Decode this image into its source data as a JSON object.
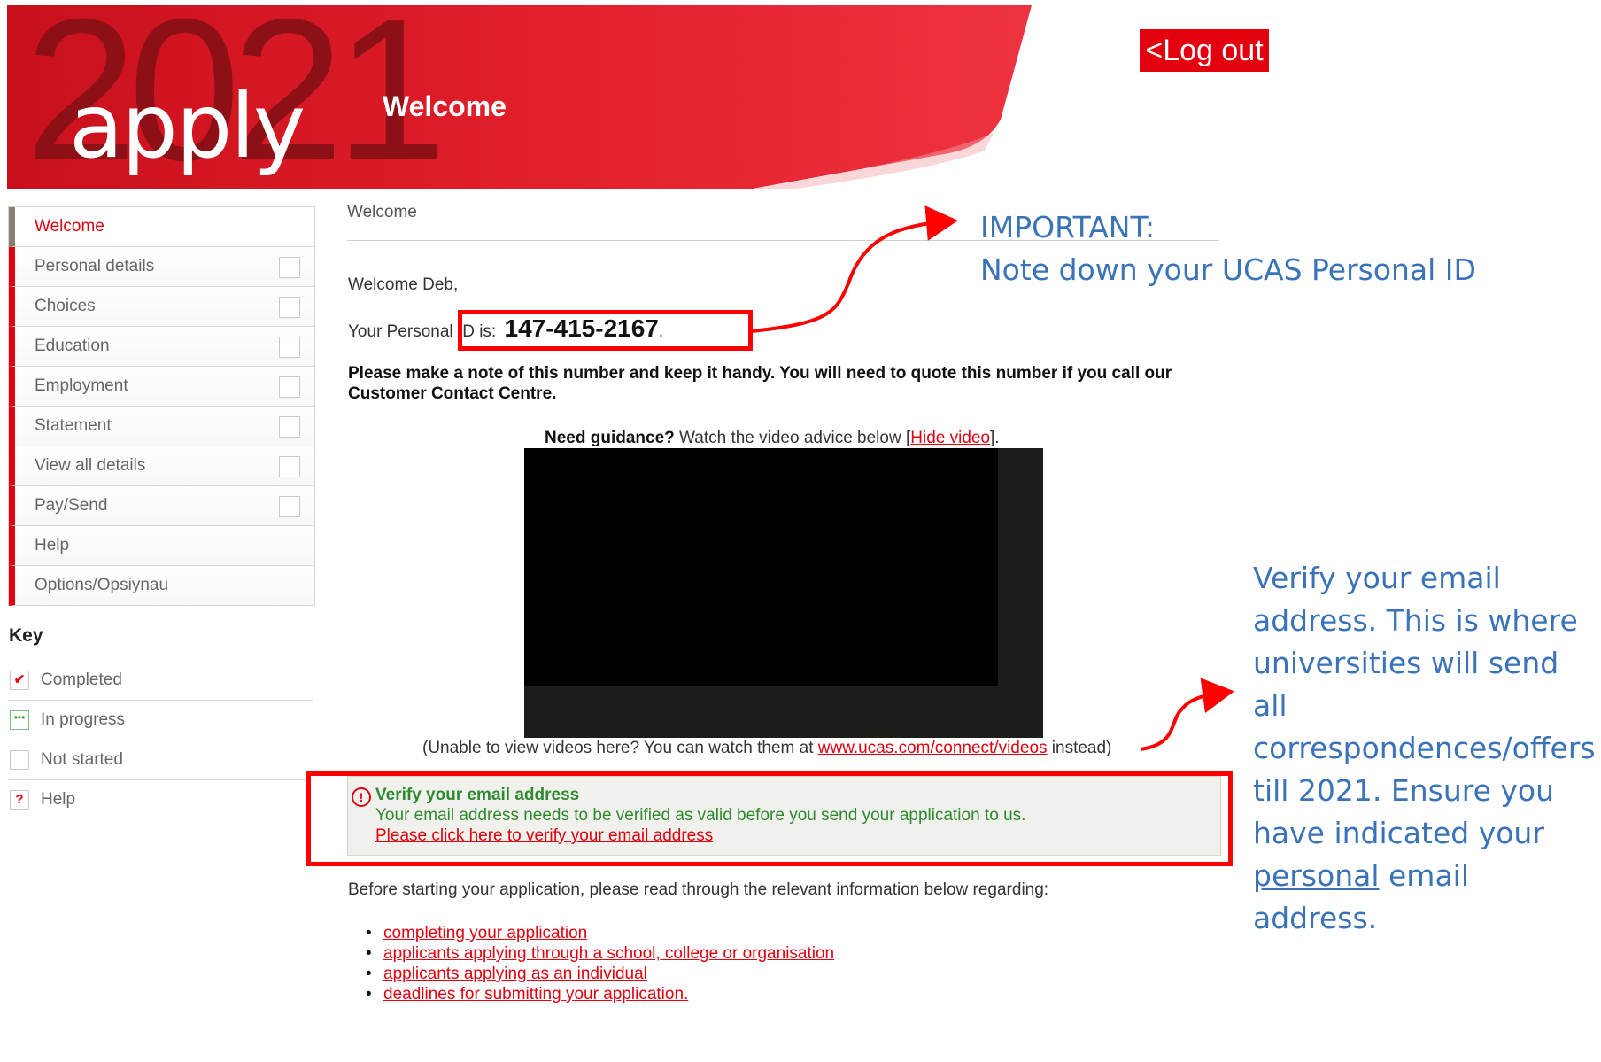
{
  "header": {
    "brand_year": "2021",
    "brand_name": "apply",
    "title": "Welcome",
    "logout_label": "<Log out"
  },
  "colors": {
    "brand_red": "#e3000f",
    "dark_red": "#8e1017",
    "success_green": "#2f8a2f",
    "annotation_blue": "#3a73b8",
    "annotation_red": "#ff0000"
  },
  "sidebar": {
    "items": [
      {
        "label": "Welcome",
        "active": true,
        "has_status": false
      },
      {
        "label": "Personal details",
        "has_status": true
      },
      {
        "label": "Choices",
        "has_status": true
      },
      {
        "label": "Education",
        "has_status": true
      },
      {
        "label": "Employment",
        "has_status": true
      },
      {
        "label": "Statement",
        "has_status": true
      },
      {
        "label": "View all details",
        "has_status": true
      },
      {
        "label": "Pay/Send",
        "has_status": true
      },
      {
        "label": "Help",
        "has_status": false
      },
      {
        "label": "Options/Opsiynau",
        "has_status": false
      }
    ]
  },
  "key": {
    "title": "Key",
    "items": [
      {
        "label": "Completed",
        "icon": "checkmark-icon"
      },
      {
        "label": "In progress",
        "icon": "ellipsis-icon"
      },
      {
        "label": "Not started",
        "icon": "empty-box-icon"
      },
      {
        "label": "Help",
        "icon": "question-icon"
      }
    ]
  },
  "main": {
    "breadcrumb": "Welcome",
    "greeting": "Welcome Deb,",
    "personal_id_label": "Your Personal ID is:",
    "personal_id": "147-415-2167",
    "personal_id_suffix": ".",
    "note": "Please make a note of this number and keep it handy. You will need to quote this number if you call our Customer Contact Centre.",
    "guidance_bold": "Need guidance?",
    "guidance_text": " Watch the video advice below [",
    "hide_video_link": "Hide video",
    "guidance_end": "].",
    "video_note_before": "(Unable to view videos here? You can watch them at ",
    "video_note_link": "www.ucas.com/connect/videos",
    "video_note_after": " instead)",
    "verify": {
      "title": "Verify your email address",
      "text": "Your email address needs to be verified as valid before you send your application to us.",
      "link": "Please click here to verify your email address"
    },
    "before_text": "Before starting your application, please read through the relevant information below regarding:",
    "links": [
      "completing your application",
      "applicants applying through a school, college or organisation",
      "applicants applying as an individual",
      "deadlines for submitting your application."
    ]
  },
  "annotations": {
    "important_line1": "IMPORTANT:",
    "important_line2": "Note down your UCAS Personal ID",
    "verify_part1": "Verify your email address. This is where universities will send all correspondences/offers till 2021. Ensure you have indicated your ",
    "verify_underlined": "personal",
    "verify_part2": " email address."
  }
}
